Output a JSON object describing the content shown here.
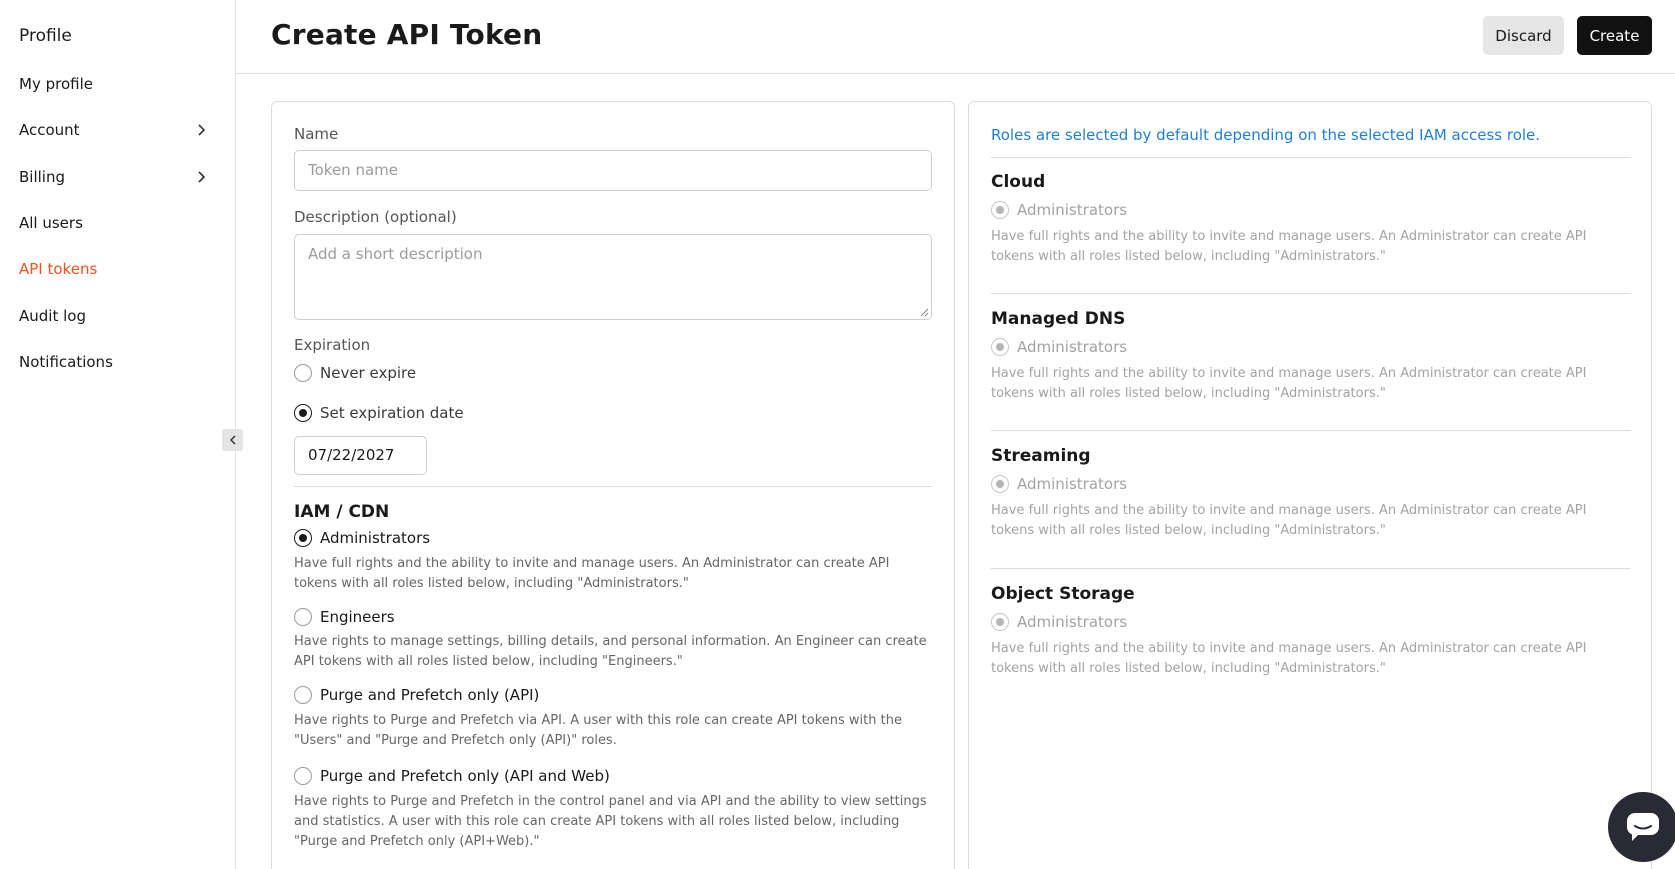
{
  "sidebar": {
    "title": "Profile",
    "items": [
      {
        "label": "My profile"
      },
      {
        "label": "Account"
      },
      {
        "label": "Billing"
      },
      {
        "label": "All users"
      },
      {
        "label": "API tokens"
      },
      {
        "label": "Audit log"
      },
      {
        "label": "Notifications"
      }
    ],
    "accent_color": "#f4511e"
  },
  "header": {
    "title": "Create API Token",
    "discard_label": "Discard",
    "create_label": "Create"
  },
  "form": {
    "name_label": "Name",
    "name_placeholder": "Token name",
    "description_label": "Description (optional)",
    "description_placeholder": "Add a short description",
    "expiration_label": "Expiration",
    "expiration_options": [
      {
        "label": "Never expire",
        "checked": false
      },
      {
        "label": "Set expiration date",
        "checked": true
      }
    ],
    "expiration_date": "07/22/2027",
    "iam_title": "IAM / CDN",
    "iam_roles": [
      {
        "label": "Administrators",
        "checked": true,
        "desc": "Have full rights and the ability to invite and manage users. An Administrator can create API tokens with all roles listed below, including \"Administrators.\""
      },
      {
        "label": "Engineers",
        "checked": false,
        "desc": "Have rights to manage settings, billing details, and personal information. An Engineer can create API tokens with all roles listed below, including \"Engineers.\""
      },
      {
        "label": "Purge and Prefetch only (API)",
        "checked": false,
        "desc": "Have rights to Purge and Prefetch via API. A user with this role can create API tokens with the \"Users\" and \"Purge and Prefetch only (API)\" roles."
      },
      {
        "label": "Purge and Prefetch only (API and Web)",
        "checked": false,
        "desc": "Have rights to Purge and Prefetch in the control panel and via API and the ability to view settings and statistics. A user with this role can create API tokens with all roles listed below, including \"Purge and Prefetch only (API+Web).\""
      }
    ]
  },
  "roles_panel": {
    "info": "Roles are selected by default depending on the selected IAM access role.",
    "info_color": "#1e7fd4",
    "products": [
      {
        "title": "Cloud",
        "role": "Administrators",
        "desc": "Have full rights and the ability to invite and manage users. An Administrator can create API tokens with all roles listed below, including \"Administrators.\""
      },
      {
        "title": "Managed DNS",
        "role": "Administrators",
        "desc": "Have full rights and the ability to invite and manage users. An Administrator can create API tokens with all roles listed below, including \"Administrators.\""
      },
      {
        "title": "Streaming",
        "role": "Administrators",
        "desc": "Have full rights and the ability to invite and manage users. An Administrator can create API tokens with all roles listed below, including \"Administrators.\""
      },
      {
        "title": "Object Storage",
        "role": "Administrators",
        "desc": "Have full rights and the ability to invite and manage users. An Administrator can create API tokens with all roles listed below, including \"Administrators.\""
      }
    ]
  },
  "chat": {
    "icon": "chat-icon"
  }
}
